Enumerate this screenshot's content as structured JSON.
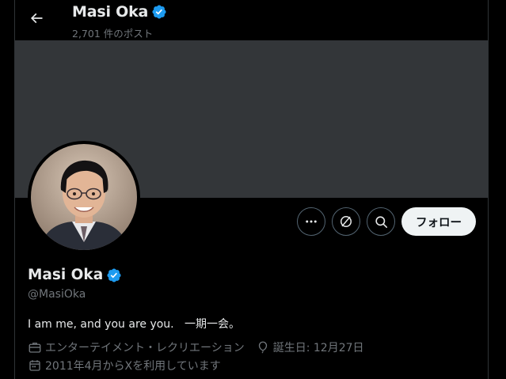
{
  "header": {
    "name": "Masi Oka",
    "posts_count": "2,701 件のポスト"
  },
  "profile": {
    "name": "Masi Oka",
    "handle": "@MasiOka",
    "bio": "I am me, and you are you.   一期一会。",
    "category": "エンターテイメント・レクリエーション",
    "birthday": "誕生日: 12月27日",
    "joined": "2011年4月からXを利用しています"
  },
  "actions": {
    "follow_label": "フォロー"
  },
  "icons": {
    "back": "arrow-left-icon",
    "verified": "verified-badge-icon",
    "more": "more-dots-icon",
    "subscribe": "subscribe-icon",
    "search": "search-icon",
    "category": "briefcase-icon",
    "birthday": "balloon-icon",
    "joined": "calendar-icon"
  },
  "colors": {
    "background": "#000000",
    "banner": "#333639",
    "verified": "#1d9bf0",
    "muted_text": "#71767b",
    "text": "#e7e9ea",
    "follow_button_bg": "#eff3f4"
  }
}
